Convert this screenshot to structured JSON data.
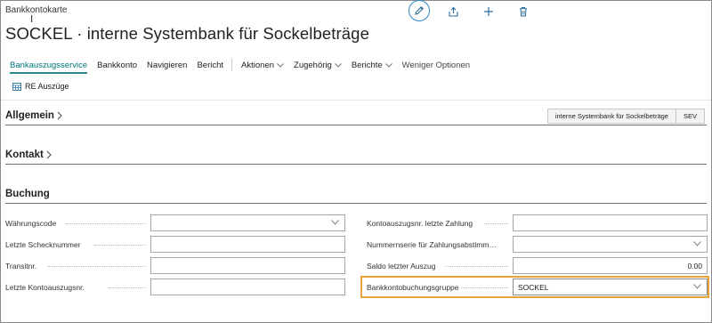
{
  "breadcrumb": "Bankkontokarte",
  "title": "SOCKEL · interne Systembank für Sockelbeträge",
  "top_actions": {
    "edit_icon": "pencil-icon",
    "share_icon": "share-icon",
    "add_icon": "plus-icon",
    "delete_icon": "trash-icon"
  },
  "action_bar": {
    "items": [
      {
        "label": "Bankauszugsservice",
        "active": true
      },
      {
        "label": "Bankkonto"
      },
      {
        "label": "Navigieren"
      },
      {
        "label": "Bericht"
      }
    ],
    "dropdowns": [
      {
        "label": "Aktionen"
      },
      {
        "label": "Zugehörig"
      },
      {
        "label": "Berichte"
      }
    ],
    "less_options": "Weniger Optionen"
  },
  "sub_action": {
    "label": "RE Auszüge",
    "icon": "table-icon"
  },
  "sections": {
    "allgemein": {
      "title": "Allgemein",
      "pills": [
        "interne Systembank für Sockelbeträge",
        "SEV"
      ]
    },
    "kontakt": {
      "title": "Kontakt"
    },
    "buchung": {
      "title": "Buchung"
    }
  },
  "fields_left": [
    {
      "label": "Währungscode",
      "value": "",
      "type": "select"
    },
    {
      "label": "Letzte Schecknummer",
      "value": "",
      "type": "text"
    },
    {
      "label": "Transitnr.",
      "value": "",
      "type": "text"
    },
    {
      "label": "Letzte Kontoauszugsnr.",
      "value": "",
      "type": "text"
    }
  ],
  "fields_right": [
    {
      "label": "Kontoauszugsnr. letzte Zahlung",
      "value": "",
      "type": "text"
    },
    {
      "label": "Nummernserie für Zahlungsabstimm…",
      "value": "",
      "type": "select"
    },
    {
      "label": "Saldo letzter Auszug",
      "value": "0.00",
      "type": "text"
    },
    {
      "label": "Bankkontobuchungsgruppe",
      "value": "SOCKEL",
      "type": "select",
      "focused": true
    }
  ],
  "colors": {
    "accent": "#00757a",
    "focus": "#e2a33a",
    "edit_ring": "#2b88c4"
  }
}
